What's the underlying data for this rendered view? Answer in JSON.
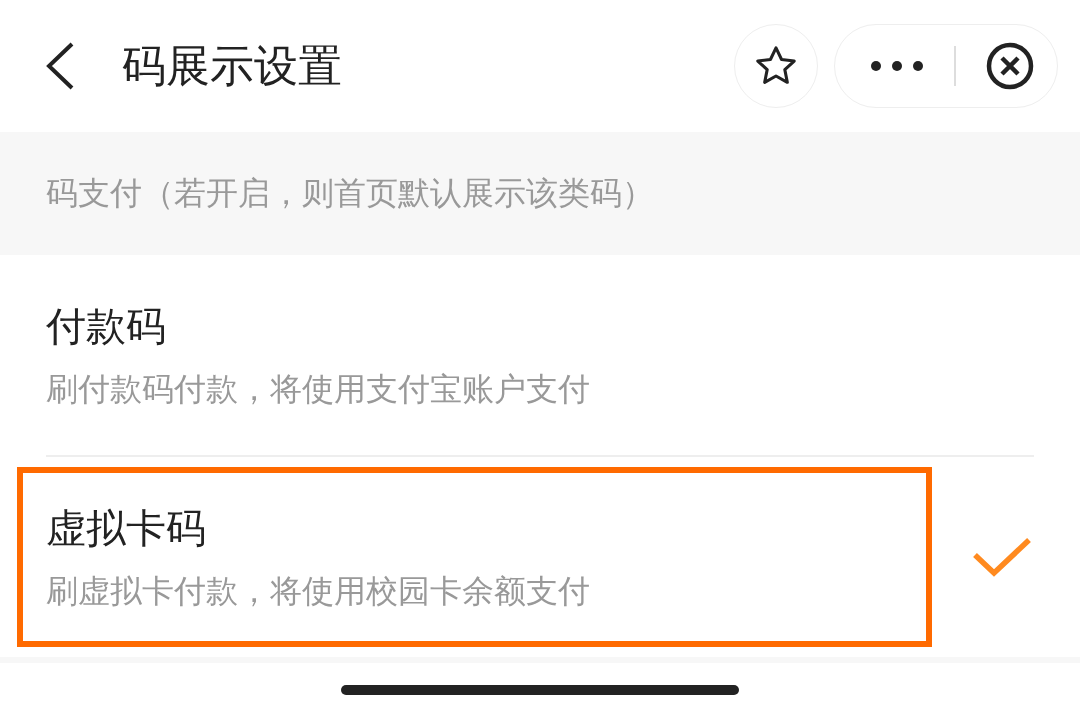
{
  "nav": {
    "title": "码展示设置"
  },
  "section": {
    "header": "码支付（若开启，则首页默认展示该类码）"
  },
  "options": [
    {
      "title": "付款码",
      "subtitle": "刷付款码付款，将使用支付宝账户支付",
      "selected": false,
      "highlighted": false
    },
    {
      "title": "虚拟卡码",
      "subtitle": "刷虚拟卡付款，将使用校园卡余额支付",
      "selected": true,
      "highlighted": true
    }
  ]
}
